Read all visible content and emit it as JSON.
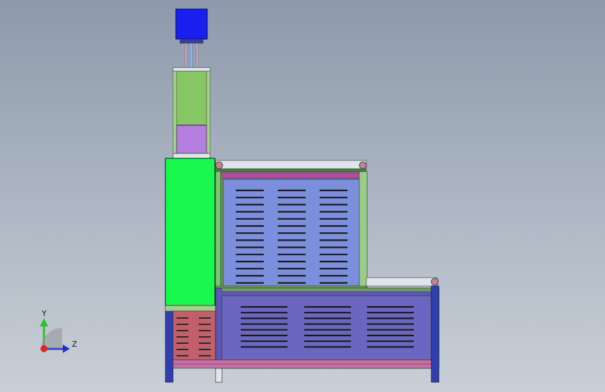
{
  "viewport": {
    "background_top": "#8d9aaa",
    "background_bottom": "#c9cfd7"
  },
  "model_colors": {
    "motor": "#1a1ff0",
    "column_green": "#86c663",
    "column_purple": "#b47fe0",
    "side_panel": "#19f94d",
    "upper_panel": "#7c8fdc",
    "lower_panel": "#6a67c0",
    "small_panel": "#c1606a",
    "frame": "#2f3fb0"
  },
  "triad": {
    "y_label": "Y",
    "z_label": "Z",
    "icon": "coordinate-triad-icon"
  }
}
